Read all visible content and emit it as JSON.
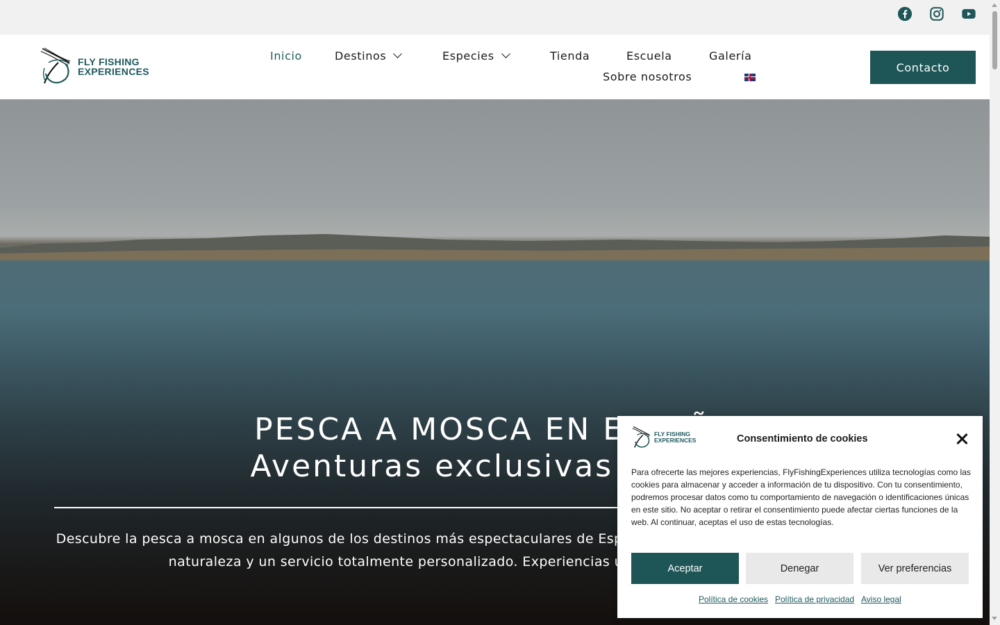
{
  "social": {
    "facebook_icon": "facebook-icon",
    "instagram_icon": "instagram-icon",
    "youtube_icon": "youtube-icon"
  },
  "brand": {
    "logo_line1": "FLY FISHING",
    "logo_line2": "EXPERIENCES",
    "color": "#1e5658"
  },
  "nav": {
    "inicio": "Inicio",
    "destinos": "Destinos",
    "especies": "Especies",
    "tienda": "Tienda",
    "escuela": "Escuela",
    "galeria": "Galería",
    "sobre": "Sobre nosotros",
    "language_icon": "uk-flag-icon"
  },
  "header": {
    "contact_label": "Contacto"
  },
  "hero": {
    "title_line1": "PESCA A MOSCA EN ESPAÑA",
    "title_line2": "Aventuras exclusivas para ti",
    "description": "Descubre la pesca a mosca en algunos de los destinos más espectaculares de España, con experiencias que combinan técnica, naturaleza y un servicio totalmente personalizado. Experiencias únicas junto a guías expertos."
  },
  "cookie": {
    "logo_line1": "FLY FISHING",
    "logo_line2": "EXPERIENCES",
    "title": "Consentimiento de cookies",
    "text": "Para ofrecerte las mejores experiencias, FlyFishingExperiences utiliza tecnologías como las cookies para almacenar y acceder a información de tu dispositivo. Con tu consentimiento, podremos procesar datos como tu comportamiento de navegación o identificaciones únicas en este sitio. No aceptar o retirar el consentimiento puede afectar ciertas funciones de la web. Al continuar, aceptas el uso de estas tecnologías.",
    "accept": "Aceptar",
    "deny": "Denegar",
    "prefs": "Ver preferencias",
    "link_cookies": "Política de cookies",
    "link_privacy": "Política de privacidad",
    "link_legal": "Aviso legal"
  }
}
